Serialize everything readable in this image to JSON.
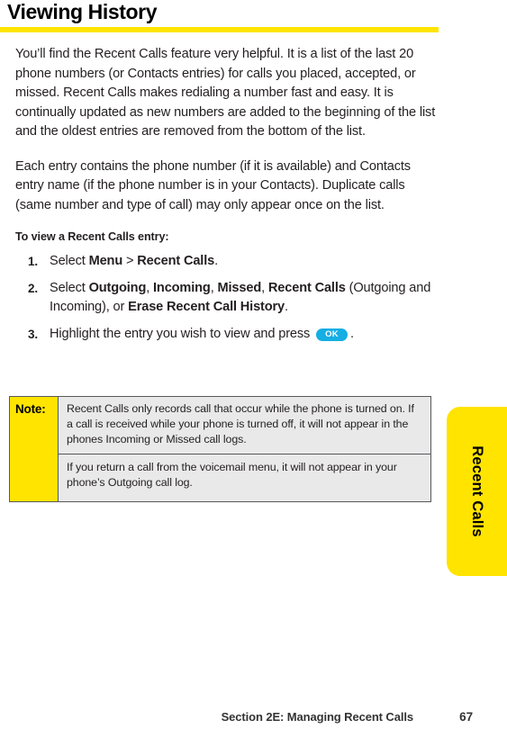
{
  "page": {
    "title": "Viewing History",
    "accent_color": "#ffe400",
    "text_color": "#231f20"
  },
  "paragraphs": {
    "p1": "You’ll find the Recent Calls feature very helpful. It is a list of the last 20 phone numbers (or Contacts entries) for calls you placed, accepted, or missed. Recent Calls makes redialing a number fast and easy. It is continually updated as new numbers are added to the beginning of the list and the oldest entries are removed from the bottom of the list.",
    "p2": "Each entry contains the phone number (if it is available) and Contacts entry name (if the phone number is in your Contacts). Duplicate calls (same number and type of call) may only appear once on the list."
  },
  "procedure": {
    "heading": "To view a Recent Calls entry:",
    "steps": [
      {
        "number": "1.",
        "prefix": "Select ",
        "bold1": "Menu",
        "mid1": " > ",
        "bold2": "Recent Calls",
        "suffix": "."
      },
      {
        "number": "2.",
        "prefix": "Select ",
        "bold1": "Outgoing",
        "sep1": ", ",
        "bold2": "Incoming",
        "sep2": ", ",
        "bold3": "Missed",
        "sep3": ", ",
        "bold4": "Recent Calls",
        "mid": " (Outgoing and Incoming), or ",
        "bold5": "Erase Recent Call History",
        "suffix": "."
      },
      {
        "number": "3.",
        "prefix": "Highlight the entry you wish to view and press ",
        "key_label": "OK",
        "key_color": "#16aee3",
        "suffix": "."
      }
    ]
  },
  "note": {
    "label": "Note:",
    "label_bg": "#ffe400",
    "body_bg": "#e9e9e9",
    "paragraphs": [
      "Recent Calls only records call that occur while the phone is turned on. If a call is received while your phone is turned off, it will not appear in the phones Incoming or Missed call logs.",
      "If you return a call from the voicemail menu, it will not appear in your phone’s Outgoing call log."
    ]
  },
  "side_tab": {
    "label": "Recent Calls",
    "color": "#ffe400"
  },
  "footer": {
    "section": "Section 2E: Managing Recent Calls",
    "page_number": "67"
  }
}
